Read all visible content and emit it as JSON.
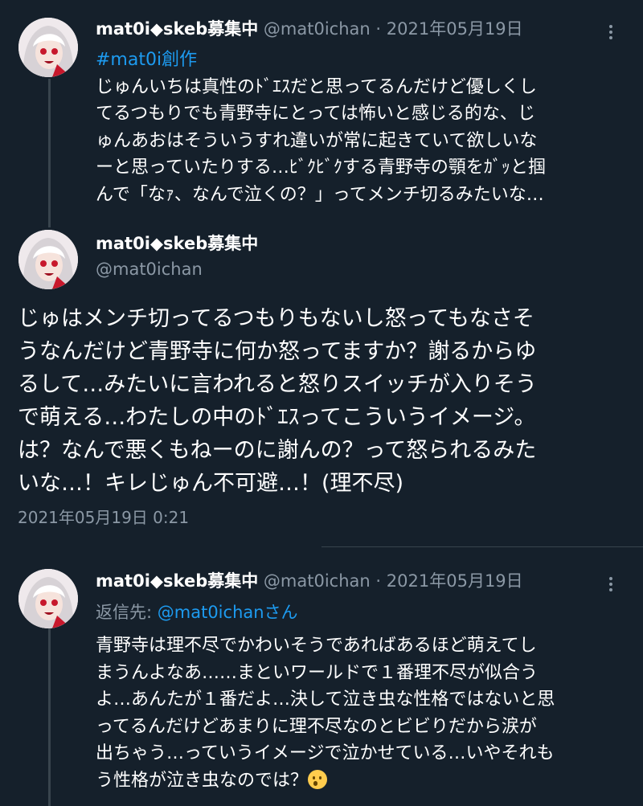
{
  "tweet1": {
    "display_name": "mat0i◆skeb募集中",
    "handle": "@mat0ichan",
    "sep": "·",
    "date": "2021年05月19日",
    "hashtag": "#mat0i創作",
    "lines": [
      "じゅんいちは真性のﾄﾞｴｽだと思ってるんだけど優しくし",
      "てるつもりでも青野寺にとっては怖いと感じる的な、じ",
      "ゅんあおはそういうすれ違いが常に起きていて欲しいな",
      "ーと思っていたりする…ﾋﾞｸﾋﾞｸする青野寺の顎をｶﾞｯと掴",
      "んで「なｧ、なんで泣くの？」ってメンチ切るみたいな…"
    ]
  },
  "main": {
    "display_name": "mat0i◆skeb募集中",
    "handle": "@mat0ichan",
    "lines": [
      "じゅはメンチ切ってるつもりもないし怒ってもなさそ",
      "うなんだけど青野寺に何か怒ってますか？謝るからゆ",
      "るして…みたいに言われると怒りスイッチが入りそう",
      "で萌える…わたしの中のﾄﾞｴｽってこういうイメージ。",
      "は？なんで悪くもねーのに謝んの？って怒られるみた",
      "いな…！キレじゅん不可避…！(理不尽)"
    ],
    "timestamp": "2021年05月19日 0:21"
  },
  "reply": {
    "display_name": "mat0i◆skeb募集中",
    "handle": "@mat0ichan",
    "sep": "·",
    "date": "2021年05月19日",
    "reply_prefix": "返信先: ",
    "reply_mention": "@mat0ichanさん",
    "lines": [
      "青野寺は理不尽でかわいそうであればあるほど萌えてし",
      "まうんよなあ……まといワールドで１番理不尽が似合う",
      "よ…あんたが１番だよ…決して泣き虫な性格ではないと思",
      "ってるんだけどあまりに理不尽なのとビビりだから涙が",
      "出ちゃう…っていうイメージで泣かせている…いやそれも",
      "う性格が泣き虫なのでは？"
    ],
    "emoji": "thinking-face-emoji"
  },
  "colors": {
    "background": "#15202b",
    "link": "#1d9bf0",
    "secondary": "#8b98a5"
  }
}
